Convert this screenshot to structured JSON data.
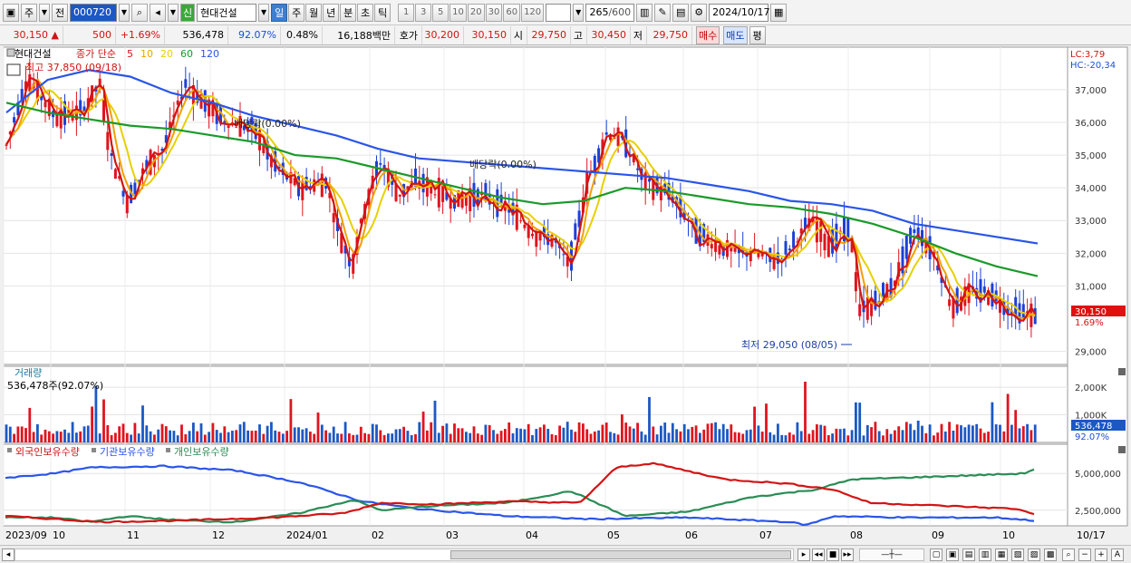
{
  "toolbar1": {
    "type_label": "주",
    "prev_label": "전",
    "code": "000720",
    "stock_name": "현대건설",
    "new_badge": "신",
    "periods": [
      "일",
      "주",
      "월",
      "년",
      "분",
      "초",
      "틱"
    ],
    "active_period": "일",
    "intervals": [
      "1",
      "3",
      "5",
      "10",
      "20",
      "30",
      "60",
      "120"
    ],
    "bar_count": "265",
    "bar_max": "/600",
    "date": "2024/10/17"
  },
  "toolbar2": {
    "price": "30,150",
    "change": "500",
    "change_pct": "+1.69%",
    "volume": "536,478",
    "volume_ratio": "92.07%",
    "turnover_pct": "0.48%",
    "amount": "16,188백만",
    "quote_label": "호가",
    "ask": "30,200",
    "bid": "30,150",
    "open_label": "시",
    "open": "29,750",
    "high_label": "고",
    "high": "30,450",
    "low_label": "저",
    "low": "29,750",
    "buy_label": "매수",
    "sell_label": "매도",
    "flat_label": "평"
  },
  "main_panel": {
    "title": "현대건설",
    "ma_label": "종가 단순",
    "ma_periods": [
      "5",
      "10",
      "20",
      "60",
      "120"
    ],
    "ma_colors": [
      "#d21414",
      "#f2a000",
      "#e8d000",
      "#1a9a2a",
      "#2a55e8"
    ],
    "high_note": "최고 37,850 (09/18)",
    "low_note": "최저 29,050 (08/05)",
    "dividend_note1": "배당락(0.00%)",
    "dividend_note2": "배당락(0.00%)",
    "lc": "LC:3,79",
    "hc": "HC:-20,34",
    "y_labels": [
      "37,000",
      "36,000",
      "35,000",
      "34,000",
      "33,000",
      "32,000",
      "31,000",
      "29,000"
    ],
    "current_price": "30,150",
    "current_pct": "1.69%"
  },
  "volume_panel": {
    "title": "거래량",
    "value": "536,478주(92.07%)",
    "y_labels": [
      "2,000K",
      "1,000K"
    ],
    "current": "536,478",
    "current_pct": "92.07%"
  },
  "holding_panel": {
    "series": [
      {
        "name": "외국인보유수량",
        "color": "#d21414"
      },
      {
        "name": "기관보유수량",
        "color": "#2a55e8"
      },
      {
        "name": "개인보유수량",
        "color": "#2a8c55"
      }
    ],
    "y_labels": [
      "5,000,000",
      "2,500,000"
    ]
  },
  "x_axis": [
    "2023/09",
    "10",
    "11",
    "12",
    "2024/01",
    "02",
    "03",
    "04",
    "05",
    "06",
    "07",
    "08",
    "09",
    "10",
    "10/17"
  ],
  "chart_data": {
    "type": "line",
    "series": [
      {
        "name": "120",
        "values": [
          36.3,
          37.3,
          37.6,
          37.4,
          36.9,
          36.6,
          36.2,
          35.9,
          35.6,
          35.2,
          34.9,
          34.8,
          34.7,
          34.6,
          34.5,
          34.4,
          34.3,
          34.1,
          33.9,
          33.6,
          33.5,
          33.3,
          32.9,
          32.7,
          32.5,
          32.3
        ]
      },
      {
        "name": "60",
        "values": [
          36.6,
          36.3,
          36.1,
          35.9,
          35.8,
          35.6,
          35.4,
          35.0,
          34.9,
          34.6,
          34.3,
          34.0,
          33.7,
          33.5,
          33.6,
          34.0,
          33.9,
          33.7,
          33.5,
          33.4,
          33.2,
          32.9,
          32.5,
          32.0,
          31.6,
          31.3
        ]
      }
    ],
    "ylim": [
      28.6,
      38.3
    ]
  }
}
